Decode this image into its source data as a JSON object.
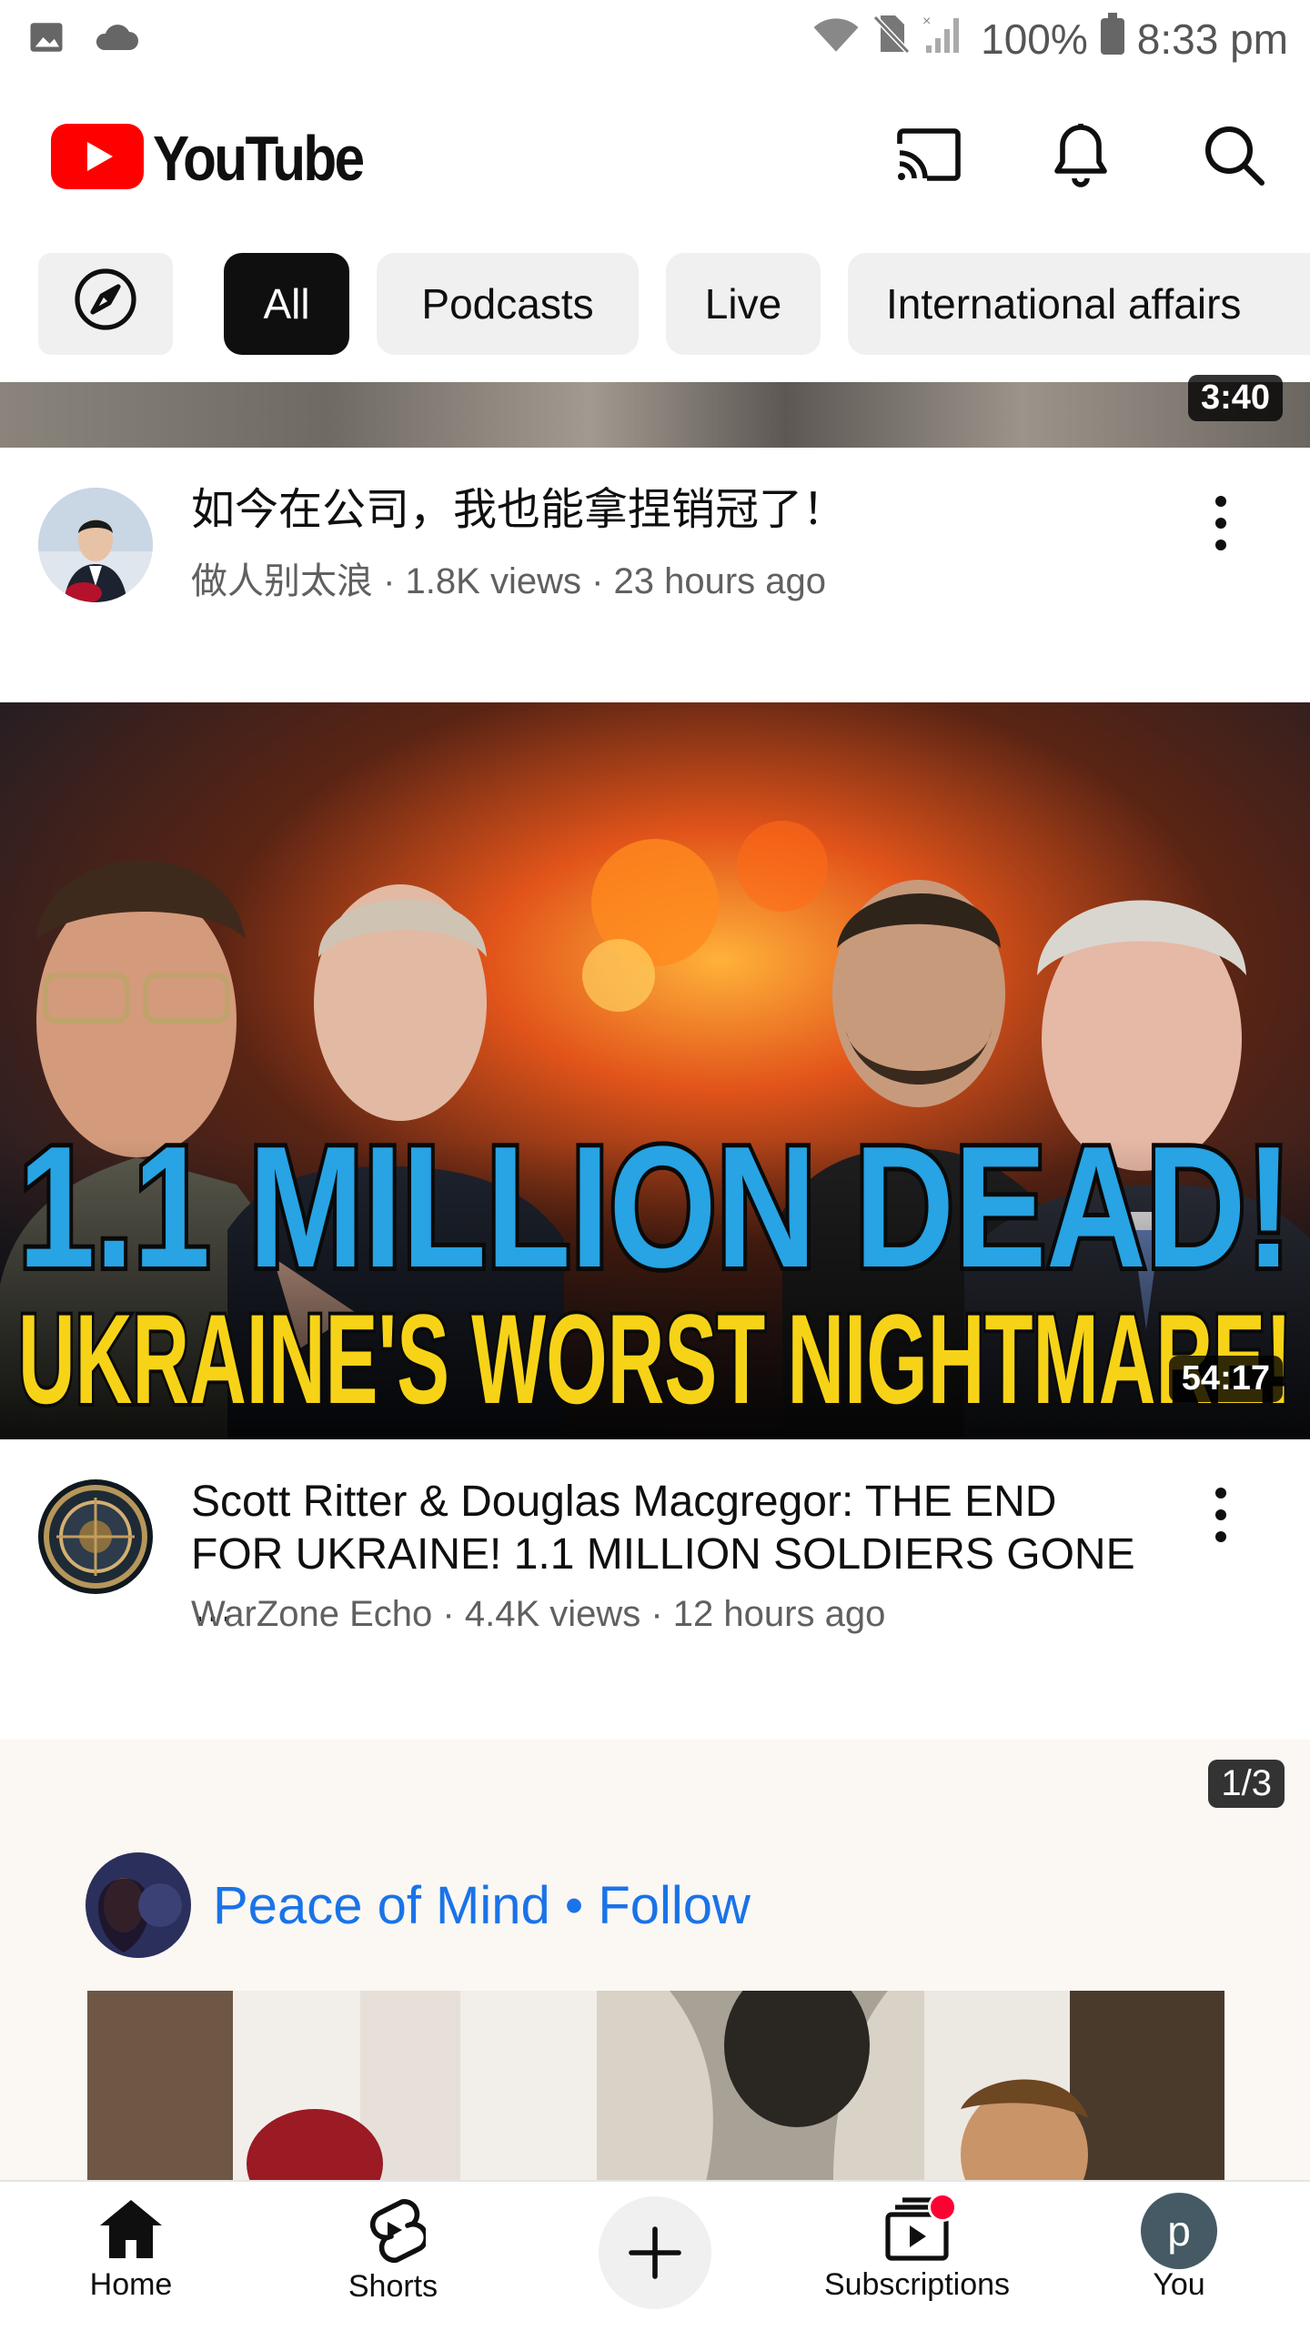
{
  "status_bar": {
    "battery": "100%",
    "time": "8:33 pm"
  },
  "header": {
    "logo_text": "YouTube"
  },
  "chips": [
    "All",
    "Podcasts",
    "Live",
    "International affairs"
  ],
  "videos": [
    {
      "duration": "3:40",
      "title": "如今在公司，我也能拿捏销冠了！",
      "meta": "做人别太浪 · 1.8K views · 23 hours ago"
    },
    {
      "duration": "54:17",
      "thumb_line1": "1.1 MILLION DEAD!",
      "thumb_line2": "UKRAINE'S WORST NIGHTMARE!",
      "title_line1": "Scott Ritter & Douglas Macgregor: THE END",
      "title_line2": "FOR UKRAINE! 1.1 MILLION SOLDIERS GONE …",
      "meta": "WarZone Echo · 4.4K views · 12 hours ago"
    }
  ],
  "shorts_shelf": {
    "counter": "1/3",
    "channel": "Peace of Mind",
    "follow": "Follow",
    "separator": " • "
  },
  "bottom_nav": [
    {
      "label": "Home"
    },
    {
      "label": "Shorts"
    },
    {
      "label": ""
    },
    {
      "label": "Subscriptions"
    },
    {
      "label": "You",
      "avatar_letter": "p"
    }
  ],
  "colors": {
    "brand_red": "#ff0000",
    "follow_blue": "#1a73e8"
  }
}
